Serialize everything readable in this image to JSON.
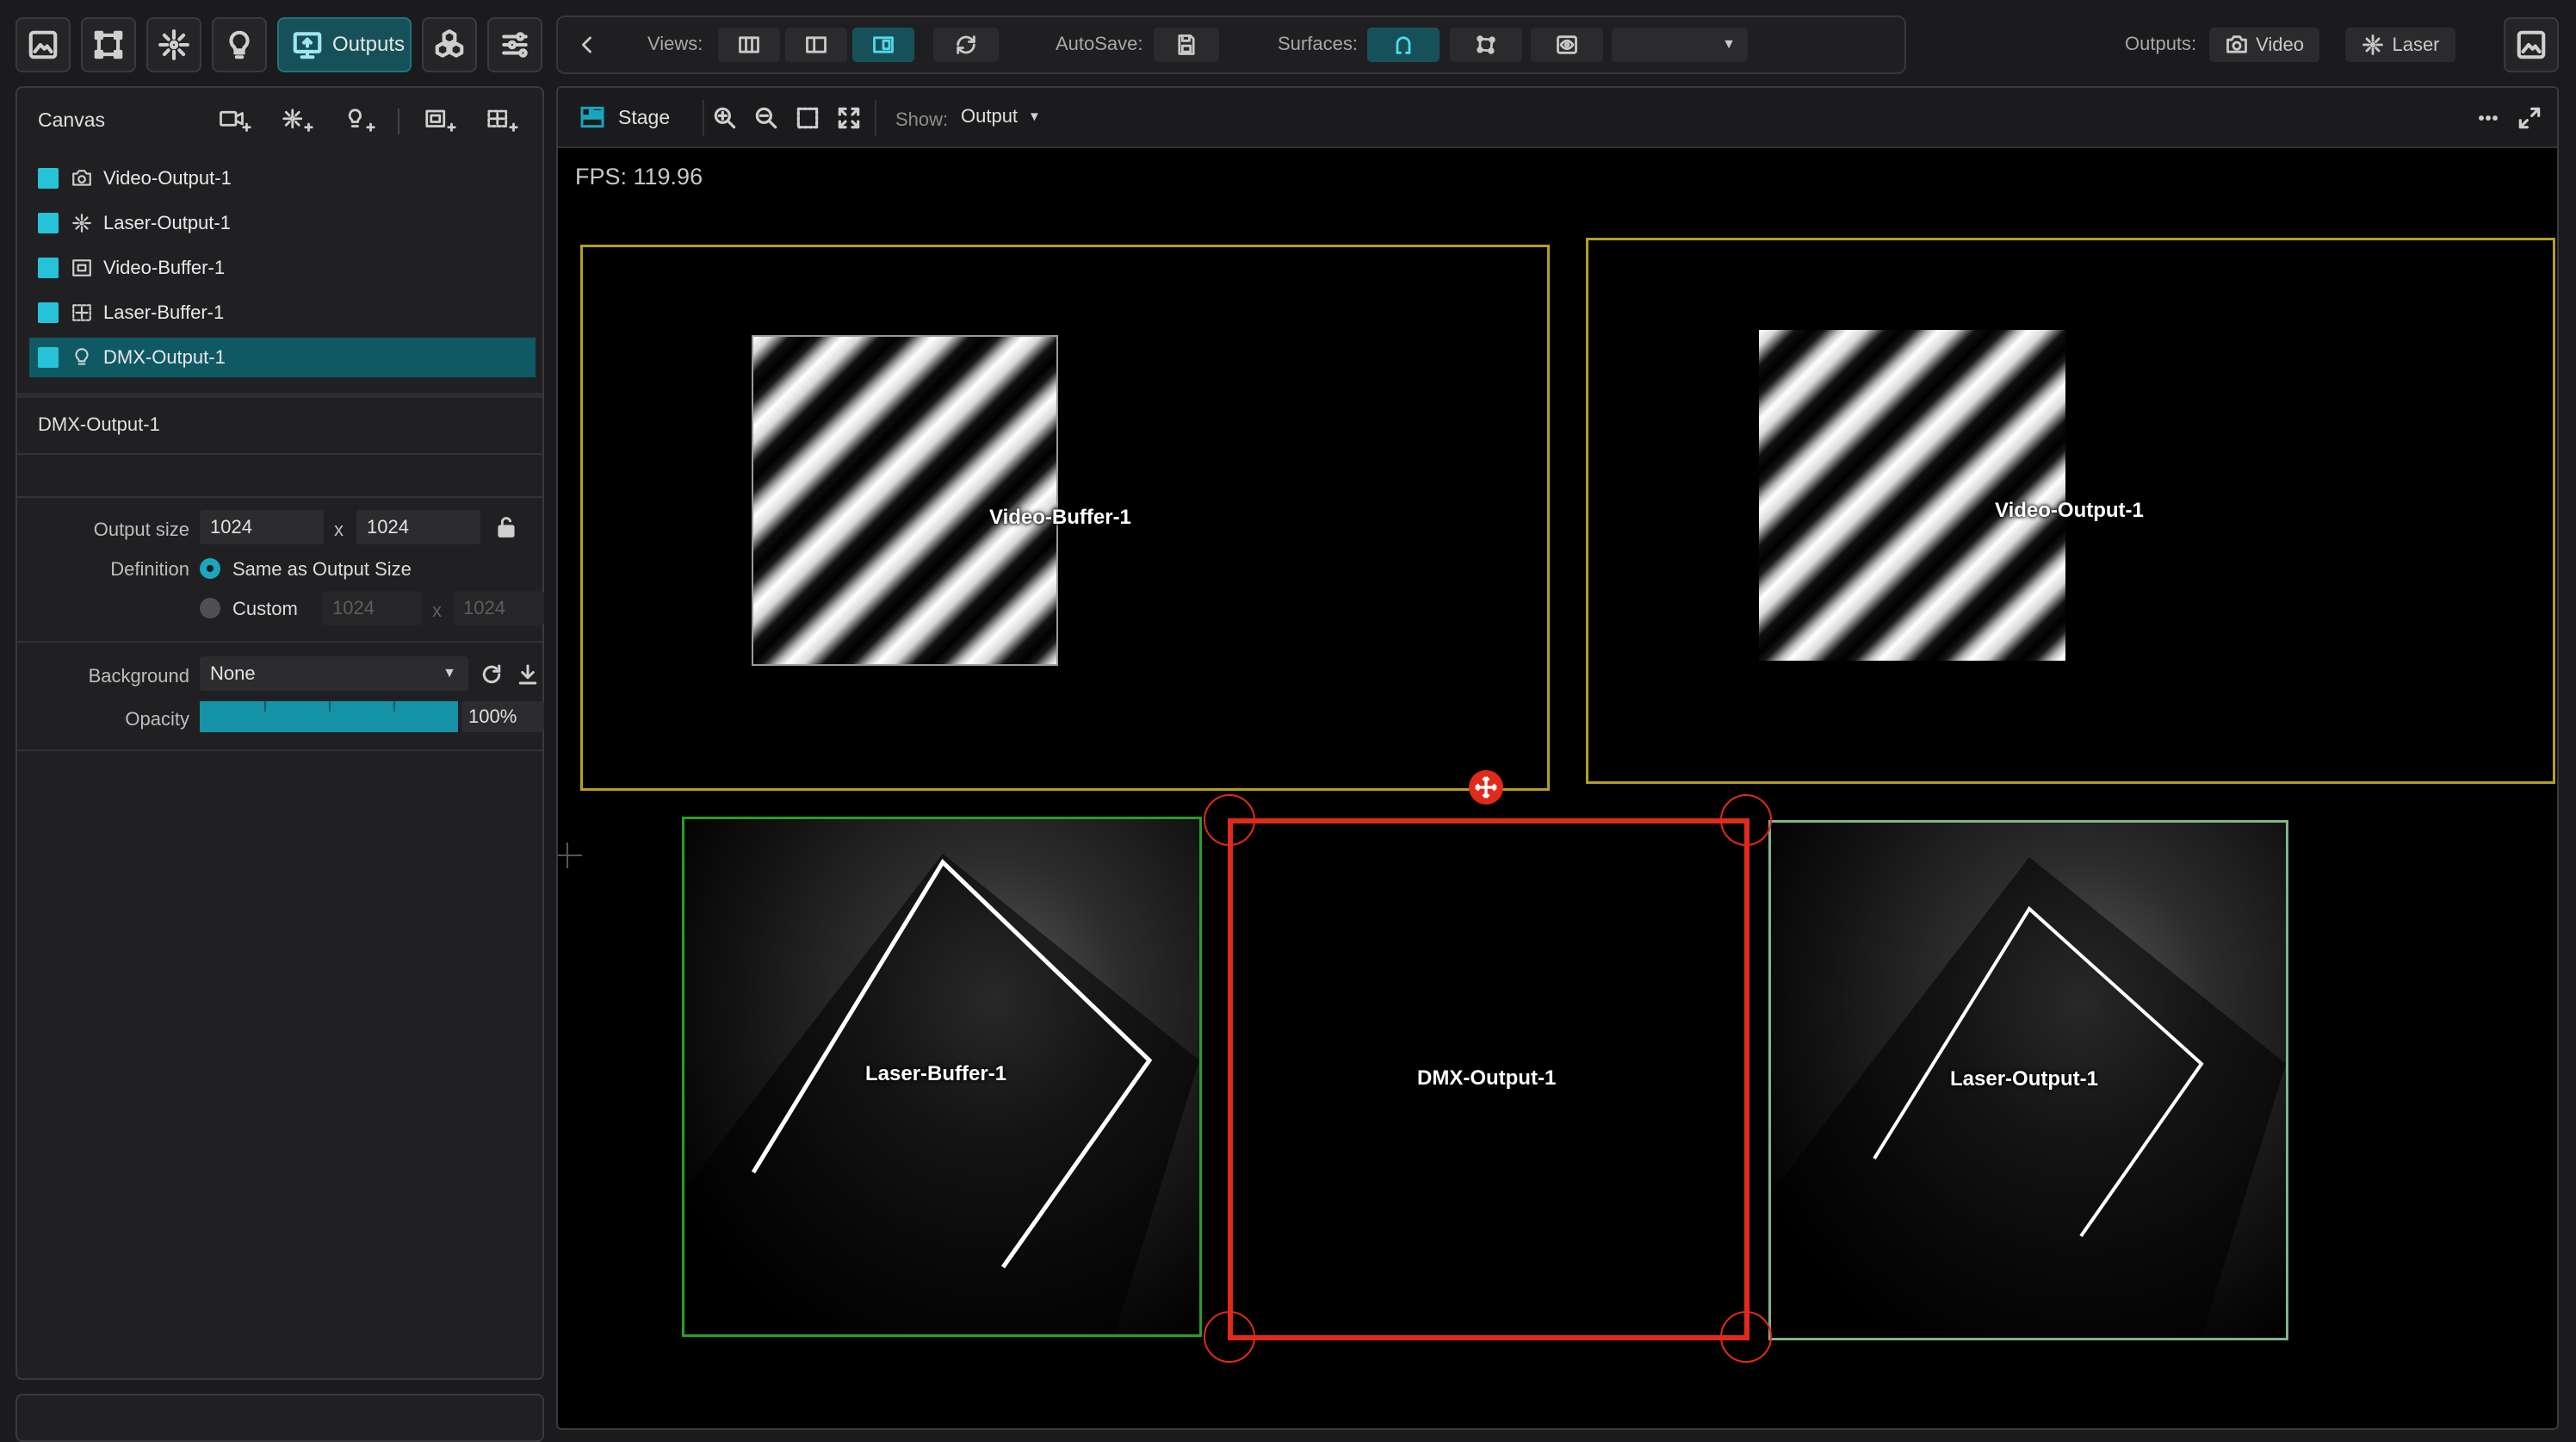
{
  "toolbar": {
    "left_tools": [
      {
        "icon": "image-icon",
        "active": false
      },
      {
        "icon": "transform-icon",
        "active": false
      },
      {
        "icon": "laser-icon",
        "active": false
      },
      {
        "icon": "bulb-icon",
        "active": false
      }
    ],
    "outputs_tab": {
      "label": "Outputs",
      "icon": "monitor-upload-icon",
      "active": true
    },
    "right_tools": [
      {
        "icon": "cubes-icon"
      },
      {
        "icon": "sliders-icon"
      }
    ],
    "views_label": "Views:",
    "autosave_label": "AutoSave:",
    "surfaces_label": "Surfaces:",
    "surfaces_dropdown_value": "",
    "outputs_label": "Outputs:",
    "video_button": "Video",
    "laser_button": "Laser"
  },
  "canvas_panel": {
    "title": "Canvas",
    "layers": [
      {
        "name": "Video-Output-1",
        "icon": "video-output-icon",
        "selected": false
      },
      {
        "name": "Laser-Output-1",
        "icon": "laser-output-icon",
        "selected": false
      },
      {
        "name": "Video-Buffer-1",
        "icon": "video-buffer-icon",
        "selected": false
      },
      {
        "name": "Laser-Buffer-1",
        "icon": "laser-buffer-icon",
        "selected": false
      },
      {
        "name": "DMX-Output-1",
        "icon": "bulb-icon",
        "selected": true
      }
    ],
    "swatch_color": "#26c2d8",
    "selected_color": "#0f5965"
  },
  "properties": {
    "title": "DMX-Output-1",
    "output_size_label": "Output size",
    "output_width": "1024",
    "output_height": "1024",
    "times": "x",
    "definition_label": "Definition",
    "option_same": "Same as Output Size",
    "option_custom": "Custom",
    "custom_width": "1024",
    "custom_height": "1024",
    "background_label": "Background",
    "background_value": "None",
    "opacity_label": "Opacity",
    "opacity_value": "100%",
    "opacity_fraction": 1.0
  },
  "stage": {
    "tab_label": "Stage",
    "show_label": "Show:",
    "show_value": "Output",
    "fps": "FPS: 119.96",
    "surfaces": [
      {
        "name": "Video-Buffer-1",
        "border": "#b3a021"
      },
      {
        "name": "Video-Output-1",
        "border": "#b3a021"
      },
      {
        "name": "Laser-Buffer-1",
        "border": "#2a9d2a"
      },
      {
        "name": "DMX-Output-1",
        "border": "#e02a1a"
      },
      {
        "name": "Laser-Output-1",
        "border": "#7fb58a"
      }
    ]
  },
  "accent_color": "#1aa6bd"
}
